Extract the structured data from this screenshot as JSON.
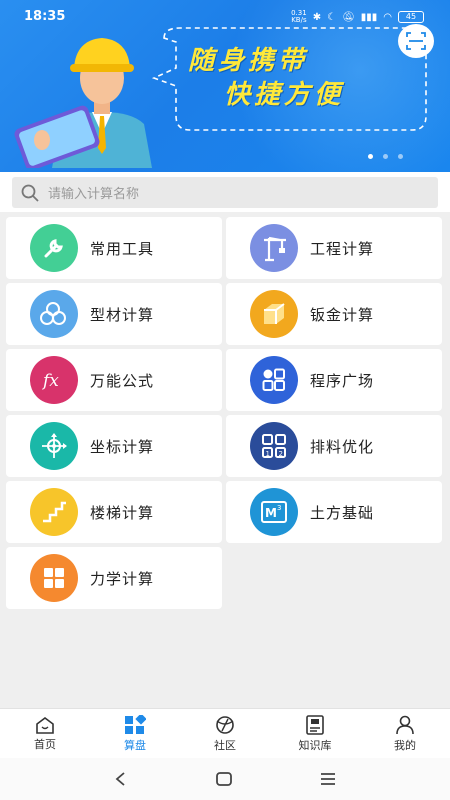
{
  "status_bar": {
    "time": "18:35",
    "net_speed_value": "0.31",
    "net_speed_unit": "KB/s",
    "battery": "45"
  },
  "banner": {
    "slogan_line1": "随身携带",
    "slogan_line2": "快捷方便"
  },
  "search": {
    "placeholder": "请输入计算名称"
  },
  "tools": [
    {
      "label": "常用工具",
      "icon": "wrench-icon",
      "color": "#43cf95"
    },
    {
      "label": "工程计算",
      "icon": "crane-icon",
      "color": "#7b8fe2"
    },
    {
      "label": "型材计算",
      "icon": "pipes-icon",
      "color": "#5aa8ea"
    },
    {
      "label": "钣金计算",
      "icon": "sheet-metal-icon",
      "color": "#f2a81e"
    },
    {
      "label": "万能公式",
      "icon": "fx-icon",
      "color": "#d8336b"
    },
    {
      "label": "程序广场",
      "icon": "apps-icon",
      "color": "#2f63d9"
    },
    {
      "label": "坐标计算",
      "icon": "coordinate-icon",
      "color": "#1ab8a8"
    },
    {
      "label": "排料优化",
      "icon": "layout-icon",
      "color": "#2a4c9a"
    },
    {
      "label": "楼梯计算",
      "icon": "stairs-icon",
      "color": "#f7c52a"
    },
    {
      "label": "土方基础",
      "icon": "m3-icon",
      "color": "#1f94d6"
    },
    {
      "label": "力学计算",
      "icon": "grid-icon",
      "color": "#f5892f"
    }
  ],
  "tabbar": [
    {
      "label": "首页",
      "icon": "home-icon",
      "active": false
    },
    {
      "label": "算盘",
      "icon": "calc-icon",
      "active": true
    },
    {
      "label": "社区",
      "icon": "community-icon",
      "active": false
    },
    {
      "label": "知识库",
      "icon": "book-icon",
      "active": false
    },
    {
      "label": "我的",
      "icon": "user-icon",
      "active": false
    }
  ],
  "colors": {
    "primary": "#1f8ae8",
    "banner": "#1c7ee8",
    "slogan": "#ffe83a"
  }
}
